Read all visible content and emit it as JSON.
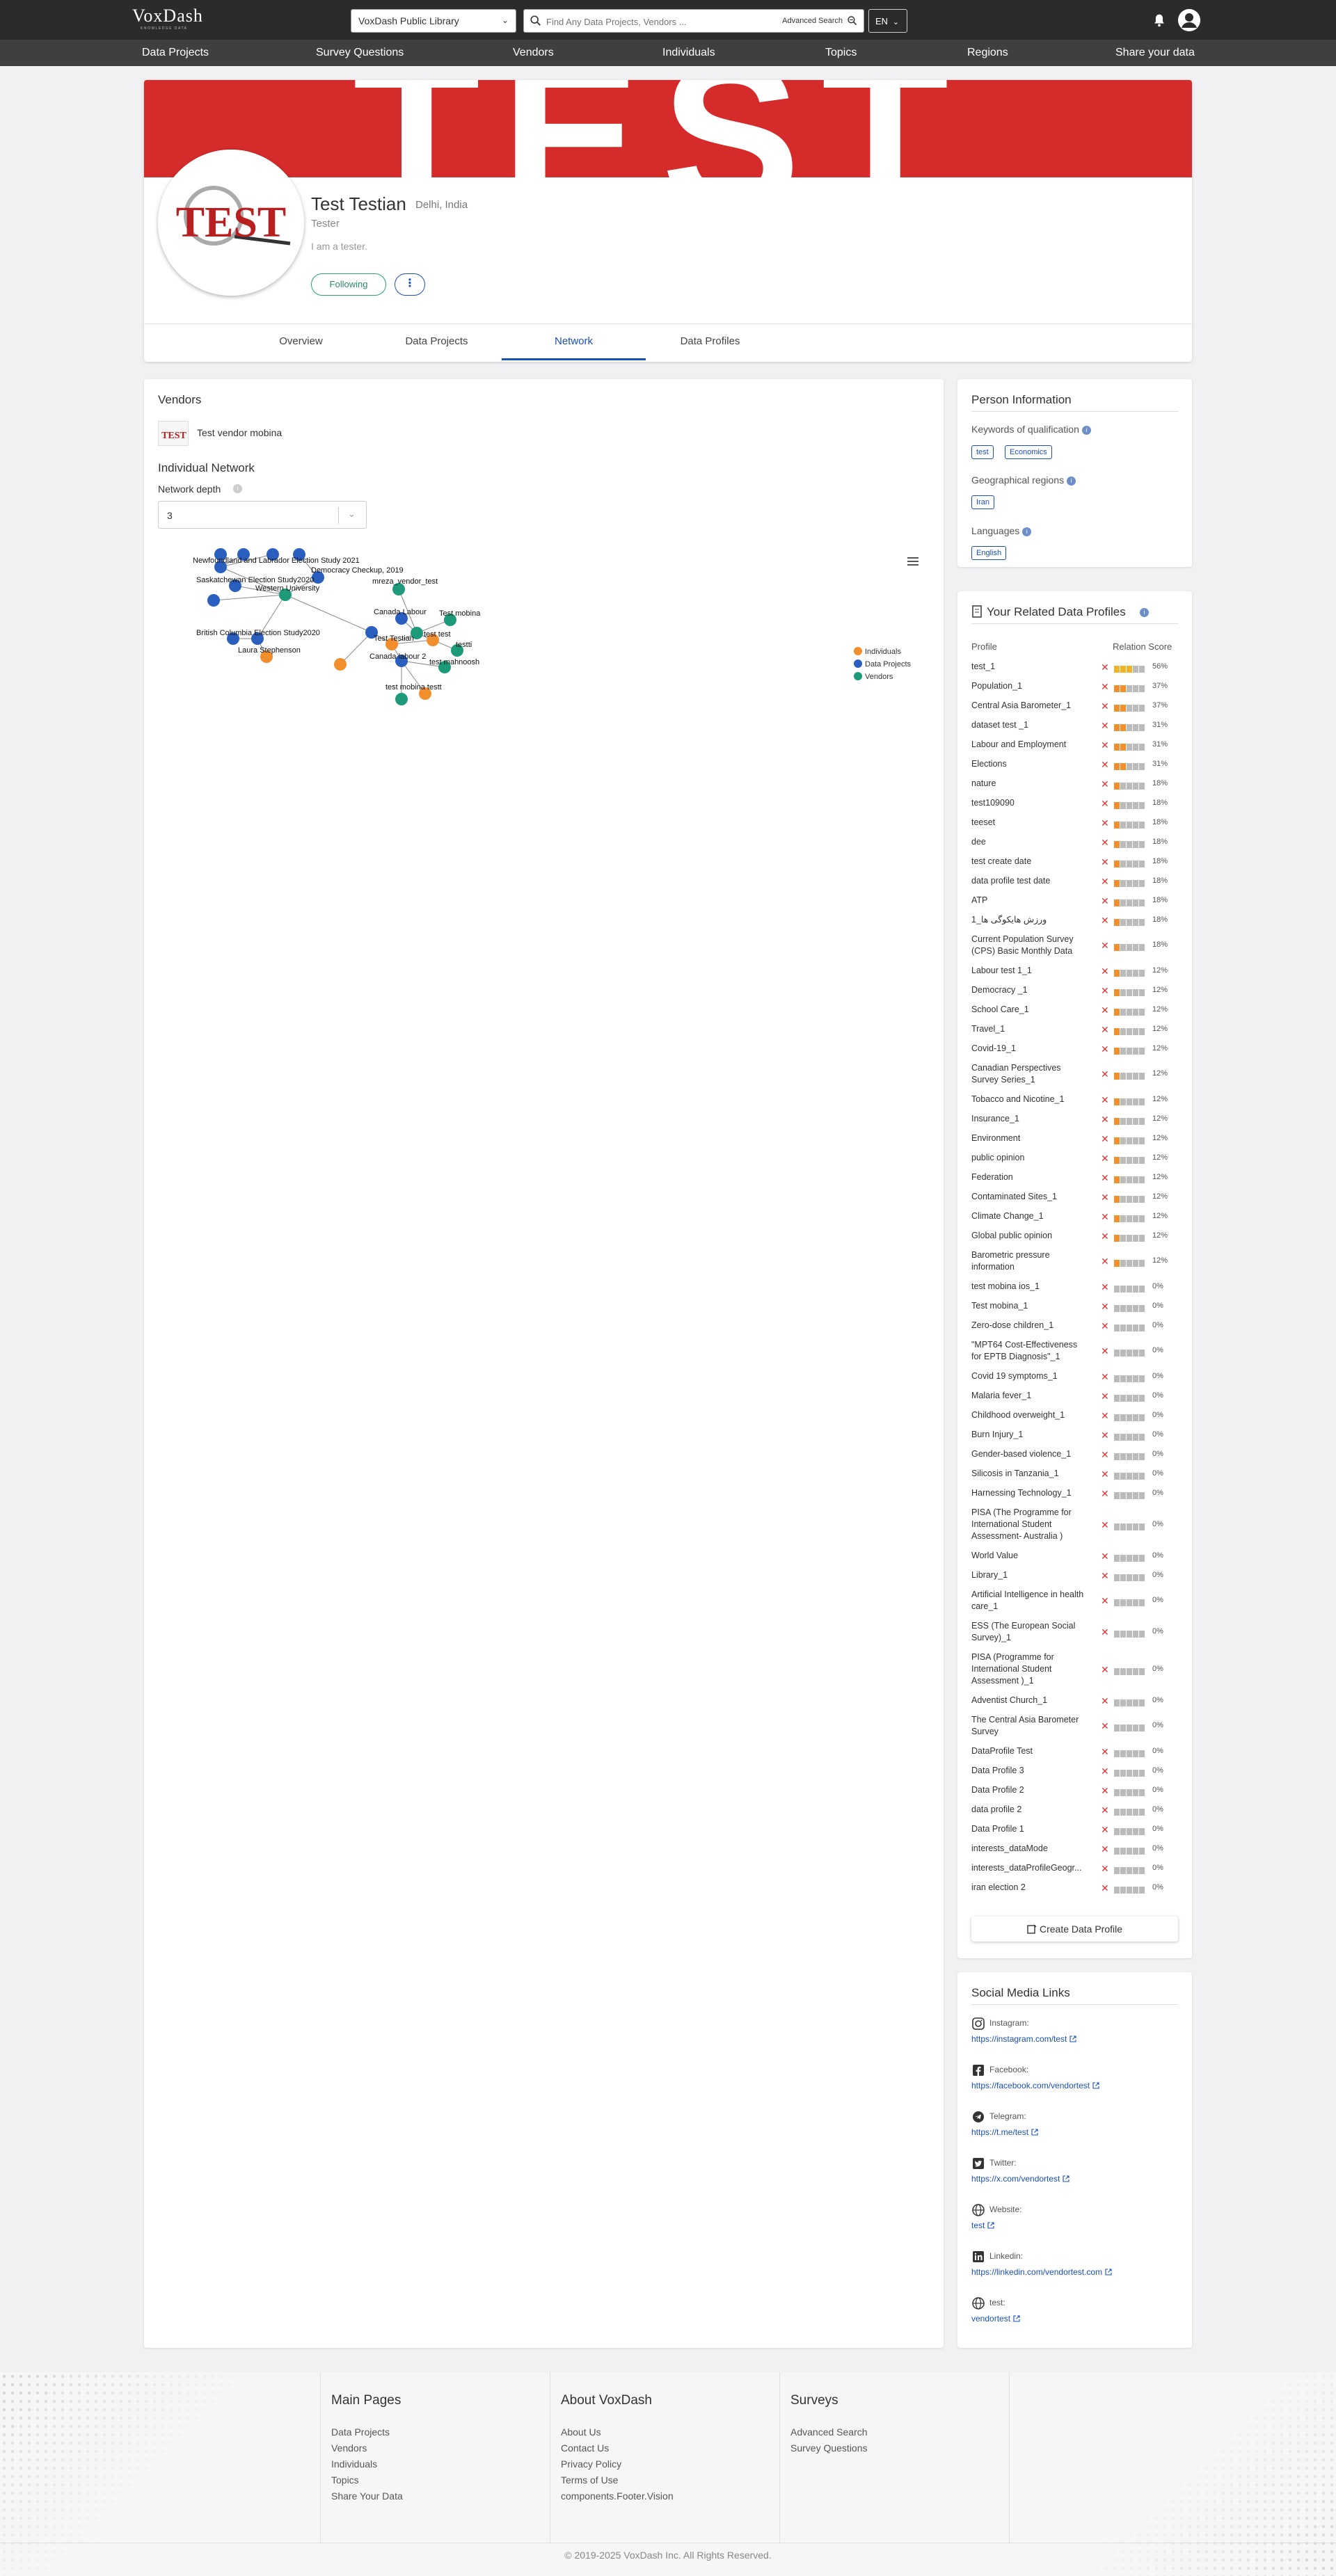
{
  "header": {
    "logo_text": "VoxDash",
    "logo_tagline": "KNOWLEDGE DATA",
    "library_select": "VoxDash Public Library",
    "search_placeholder": "Find Any Data Projects, Vendors ...",
    "advanced_search": "Advanced Search",
    "language": "EN"
  },
  "nav": [
    "Data Projects",
    "Survey Questions",
    "Vendors",
    "Individuals",
    "Topics",
    "Regions",
    "Share your data"
  ],
  "profile": {
    "cover_text": "TEST",
    "avatar_text": "TEST",
    "name": "Test Testian",
    "location": "Delhi, India",
    "role": "Tester",
    "bio": "I am a tester.",
    "following_btn": "Following",
    "more_btn": "⋮",
    "tabs": [
      "Overview",
      "Data Projects",
      "Network",
      "Data Profiles"
    ],
    "active_tab": "Network"
  },
  "main": {
    "vendors_title": "Vendors",
    "vendor_logo_text": "TEST",
    "vendor_name": "Test vendor mobina",
    "network_title": "Individual Network",
    "depth_label": "Network depth",
    "depth_value": "3",
    "legend": [
      "Individuals",
      "Data Projects",
      "Vendors"
    ],
    "colors": {
      "individuals": "#f28e2b",
      "projects": "#2a5fc0",
      "vendors": "#1c9a7a"
    },
    "graph_labels": [
      "Newfoundland and Labrador Election Study 2021",
      "Democracy Checkup, 2019",
      "Saskatchewan Election Study2020",
      "Western University",
      "British Columbia Election Study2020",
      "Laura Stephenson",
      "Canada Labour",
      "Test Testian",
      "test test",
      "mreza_vendor_test",
      "Test mobina",
      "testti",
      "Canada labour 2",
      "test mahnoosh",
      "test mobina testt"
    ]
  },
  "person_info": {
    "title": "Person Information",
    "keywords_label": "Keywords of qualification",
    "keywords": [
      "test",
      "Economics"
    ],
    "regions_label": "Geographical regions",
    "regions": [
      "Iran"
    ],
    "languages_label": "Languages",
    "languages": [
      "English"
    ]
  },
  "related": {
    "title": "Your Related Data Profiles",
    "col_profile": "Profile",
    "col_score": "Relation Score",
    "create_btn": "Create Data Profile",
    "rows": [
      {
        "name": "test_1",
        "score": "56%"
      },
      {
        "name": "Population_1",
        "score": "37%"
      },
      {
        "name": "Central Asia Barometer_1",
        "score": "37%"
      },
      {
        "name": "dataset test _1",
        "score": "31%"
      },
      {
        "name": "Labour and Employment",
        "score": "31%"
      },
      {
        "name": "Elections",
        "score": "31%"
      },
      {
        "name": "nature",
        "score": "18%"
      },
      {
        "name": "test109090",
        "score": "18%"
      },
      {
        "name": "teeset",
        "score": "18%"
      },
      {
        "name": "dee",
        "score": "18%"
      },
      {
        "name": "test create date",
        "score": "18%"
      },
      {
        "name": "data profile test date",
        "score": "18%"
      },
      {
        "name": "ATP",
        "score": "18%"
      },
      {
        "name": "ورزش هایکوگی ها_1",
        "score": "18%"
      },
      {
        "name": "Current Population Survey (CPS) Basic Monthly Data",
        "score": "18%"
      },
      {
        "name": "Labour test 1_1",
        "score": "12%"
      },
      {
        "name": "Democracy _1",
        "score": "12%"
      },
      {
        "name": "School Care_1",
        "score": "12%"
      },
      {
        "name": "Travel_1",
        "score": "12%"
      },
      {
        "name": "Covid-19_1",
        "score": "12%"
      },
      {
        "name": "Canadian Perspectives Survey Series_1",
        "score": "12%"
      },
      {
        "name": "Tobacco and Nicotine_1",
        "score": "12%"
      },
      {
        "name": "Insurance_1",
        "score": "12%"
      },
      {
        "name": "Environment",
        "score": "12%"
      },
      {
        "name": "public opinion",
        "score": "12%"
      },
      {
        "name": "Federation",
        "score": "12%"
      },
      {
        "name": "Contaminated Sites_1",
        "score": "12%"
      },
      {
        "name": "Climate Change_1",
        "score": "12%"
      },
      {
        "name": "Global public opinion",
        "score": "12%"
      },
      {
        "name": "Barometric pressure information",
        "score": "12%"
      },
      {
        "name": "test mobina ios_1",
        "score": "0%"
      },
      {
        "name": "Test mobina_1",
        "score": "0%"
      },
      {
        "name": "Zero-dose children_1",
        "score": "0%"
      },
      {
        "name": "\"MPT64 Cost-Effectiveness for EPTB Diagnosis\"_1",
        "score": "0%"
      },
      {
        "name": "Covid 19 symptoms_1",
        "score": "0%"
      },
      {
        "name": "Malaria fever_1",
        "score": "0%"
      },
      {
        "name": "Childhood overweight_1",
        "score": "0%"
      },
      {
        "name": "Burn Injury_1",
        "score": "0%"
      },
      {
        "name": "Gender-based violence_1",
        "score": "0%"
      },
      {
        "name": "Silicosis in Tanzania_1",
        "score": "0%"
      },
      {
        "name": "Harnessing Technology_1",
        "score": "0%"
      },
      {
        "name": "PISA (The Programme for International Student Assessment- Australia )",
        "score": "0%"
      },
      {
        "name": "World Value",
        "score": "0%"
      },
      {
        "name": "Library_1",
        "score": "0%"
      },
      {
        "name": "Artificial Intelligence in health care_1",
        "score": "0%"
      },
      {
        "name": "ESS (The European Social Survey)_1",
        "score": "0%"
      },
      {
        "name": "PISA (Programme for International Student Assessment )_1",
        "score": "0%"
      },
      {
        "name": "Adventist Church_1",
        "score": "0%"
      },
      {
        "name": "The Central Asia Barometer Survey",
        "score": "0%"
      },
      {
        "name": "DataProfile Test",
        "score": "0%"
      },
      {
        "name": "Data Profile 3",
        "score": "0%"
      },
      {
        "name": "Data Profile 2",
        "score": "0%"
      },
      {
        "name": "data profile 2",
        "score": "0%"
      },
      {
        "name": "Data Profile 1",
        "score": "0%"
      },
      {
        "name": "interests_dataMode",
        "score": "0%"
      },
      {
        "name": "interests_dataProfileGeogr...",
        "score": "0%"
      },
      {
        "name": "iran election 2",
        "score": "0%"
      }
    ]
  },
  "social": {
    "title": "Social Media Links",
    "items": [
      {
        "icon": "instagram-icon",
        "label": "Instagram:",
        "link": "https://instagram.com/test"
      },
      {
        "icon": "facebook-icon",
        "label": "Facebook:",
        "link": "https://facebook.com/vendortest"
      },
      {
        "icon": "telegram-icon",
        "label": "Telegram:",
        "link": "https://t.me/test"
      },
      {
        "icon": "twitter-icon",
        "label": "Twitter:",
        "link": "https://x.com/vendortest"
      },
      {
        "icon": "globe-icon",
        "label": "Website:",
        "link": "test"
      },
      {
        "icon": "linkedin-icon",
        "label": "Linkedin:",
        "link": "https://linkedin.com/vendortest.com"
      },
      {
        "icon": "globe-icon",
        "label": "test:",
        "link": "vendortest"
      }
    ]
  },
  "footer": {
    "main_pages_title": "Main Pages",
    "main_pages": [
      "Data Projects",
      "Vendors",
      "Individuals",
      "Topics",
      "Share Your Data"
    ],
    "about_title": "About VoxDash",
    "about": [
      "About Us",
      "Contact Us",
      "Privacy Policy",
      "Terms of Use",
      "components.Footer.Vision"
    ],
    "surveys_title": "Surveys",
    "surveys": [
      "Advanced Search",
      "Survey Questions"
    ],
    "copyright": "© 2019-2025 VoxDash Inc. All Rights Reserved."
  }
}
